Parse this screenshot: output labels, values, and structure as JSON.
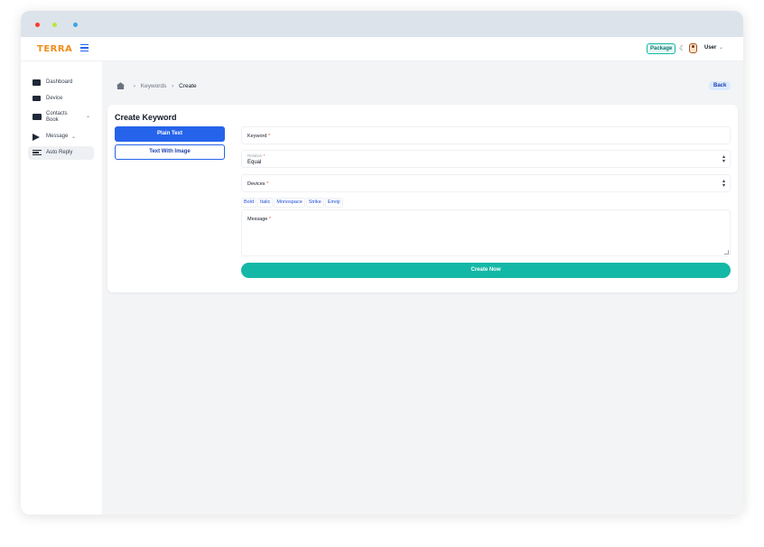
{
  "brand": {
    "logo_text": "TERRA",
    "accent_color": "#2563eb",
    "teal_color": "#14b8a6",
    "logo_color": "#f28c1a"
  },
  "topbar": {
    "package_label": "Package",
    "theme_icon": "moon-icon",
    "user_label": "User"
  },
  "sidebar": {
    "items": [
      {
        "label": "Dashboard",
        "icon": "dashboard-icon"
      },
      {
        "label": "Device",
        "icon": "device-icon"
      },
      {
        "label": "Contacts Book",
        "icon": "contacts-book-icon",
        "has_submenu": true
      },
      {
        "label": "Message",
        "icon": "message-icon",
        "has_submenu": true
      },
      {
        "label": "Auto Reply",
        "icon": "auto-reply-icon",
        "active": true
      }
    ]
  },
  "breadcrumb": {
    "items": [
      "Keywords",
      "Create"
    ],
    "home_icon": "home-icon"
  },
  "back_label": "Back",
  "form": {
    "title": "Create Keyword",
    "tabs": [
      "Plain Text",
      "Text With Image"
    ],
    "active_tab": "Plain Text",
    "keyword_label": "Keyword",
    "relation_label": "Relation",
    "relation_value": "Equal",
    "devices_label": "Devices",
    "toolbar": [
      "Bold",
      "Italic",
      "Monospace",
      "Strike",
      "Emoji"
    ],
    "message_label": "Message",
    "required_mark": "*",
    "submit_label": "Create Now"
  }
}
